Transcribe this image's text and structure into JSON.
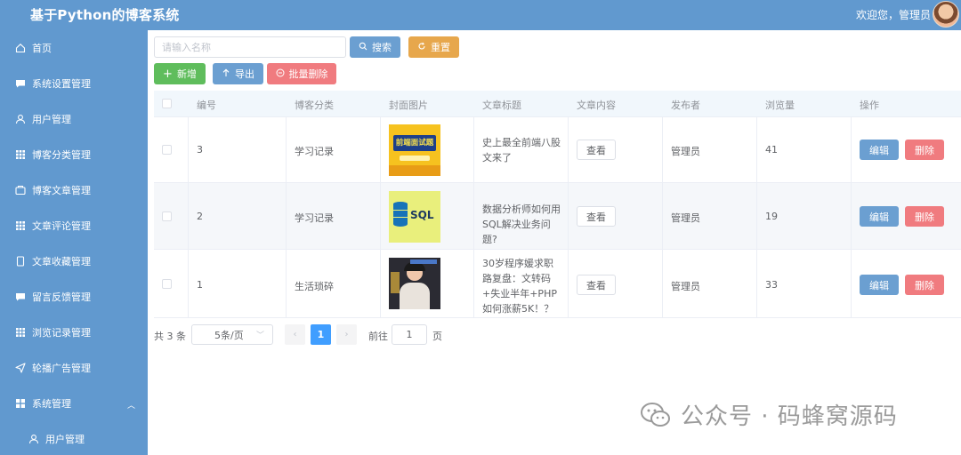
{
  "header": {
    "app_title": "基于Python的博客系统",
    "welcome": "欢迎您，管理员"
  },
  "sidebar": {
    "items": [
      {
        "label": "首页",
        "icon": "home-icon"
      },
      {
        "label": "系统设置管理",
        "icon": "chat-icon"
      },
      {
        "label": "用户管理",
        "icon": "user-icon"
      },
      {
        "label": "博客分类管理",
        "icon": "grid-icon"
      },
      {
        "label": "博客文章管理",
        "icon": "box-icon"
      },
      {
        "label": "文章评论管理",
        "icon": "grid-icon"
      },
      {
        "label": "文章收藏管理",
        "icon": "phone-icon"
      },
      {
        "label": "留言反馈管理",
        "icon": "chat-icon"
      },
      {
        "label": "浏览记录管理",
        "icon": "grid-icon"
      },
      {
        "label": "轮播广告管理",
        "icon": "send-icon"
      },
      {
        "label": "系统管理",
        "icon": "apps-icon"
      }
    ],
    "sub_items": [
      {
        "label": "用户管理",
        "icon": "user-icon"
      }
    ]
  },
  "toolbar": {
    "search_placeholder": "请输入名称",
    "search_label": "搜索",
    "reset_label": "重置",
    "add_label": "新增",
    "export_label": "导出",
    "batch_delete_label": "批量删除"
  },
  "table": {
    "columns": [
      "编号",
      "博客分类",
      "封面图片",
      "文章标题",
      "文章内容",
      "发布者",
      "浏览量",
      "操作"
    ],
    "rows": [
      {
        "id": "3",
        "category": "学习记录",
        "title": "史上最全前端八股文来了",
        "content": "查看",
        "author": "管理员",
        "views": "41",
        "edit": "编辑",
        "delete": "删除"
      },
      {
        "id": "2",
        "category": "学习记录",
        "title": "数据分析师如何用SQL解决业务问题?",
        "content": "查看",
        "author": "管理员",
        "views": "19",
        "edit": "编辑",
        "delete": "删除"
      },
      {
        "id": "1",
        "category": "生活琐碎",
        "title": "30岁程序媛求职路复盘：文转码+失业半年+PHP如何涨薪5K！？",
        "content": "查看",
        "author": "管理员",
        "views": "33",
        "edit": "编辑",
        "delete": "删除"
      }
    ],
    "cover_texts": {
      "row1": "前端面试题",
      "row2": "SQL"
    }
  },
  "pagination": {
    "total": "共 3 条",
    "page_size": "5条/页",
    "current": "1",
    "goto_label": "前往",
    "goto_value": "1",
    "unit": "页"
  },
  "watermark": "公众号 · 码蜂窝源码",
  "colors": {
    "primary": "#6199cf",
    "success": "#5fbd5c",
    "warning": "#e7a74c",
    "danger": "#f07b7f",
    "active_page": "#409eff"
  }
}
